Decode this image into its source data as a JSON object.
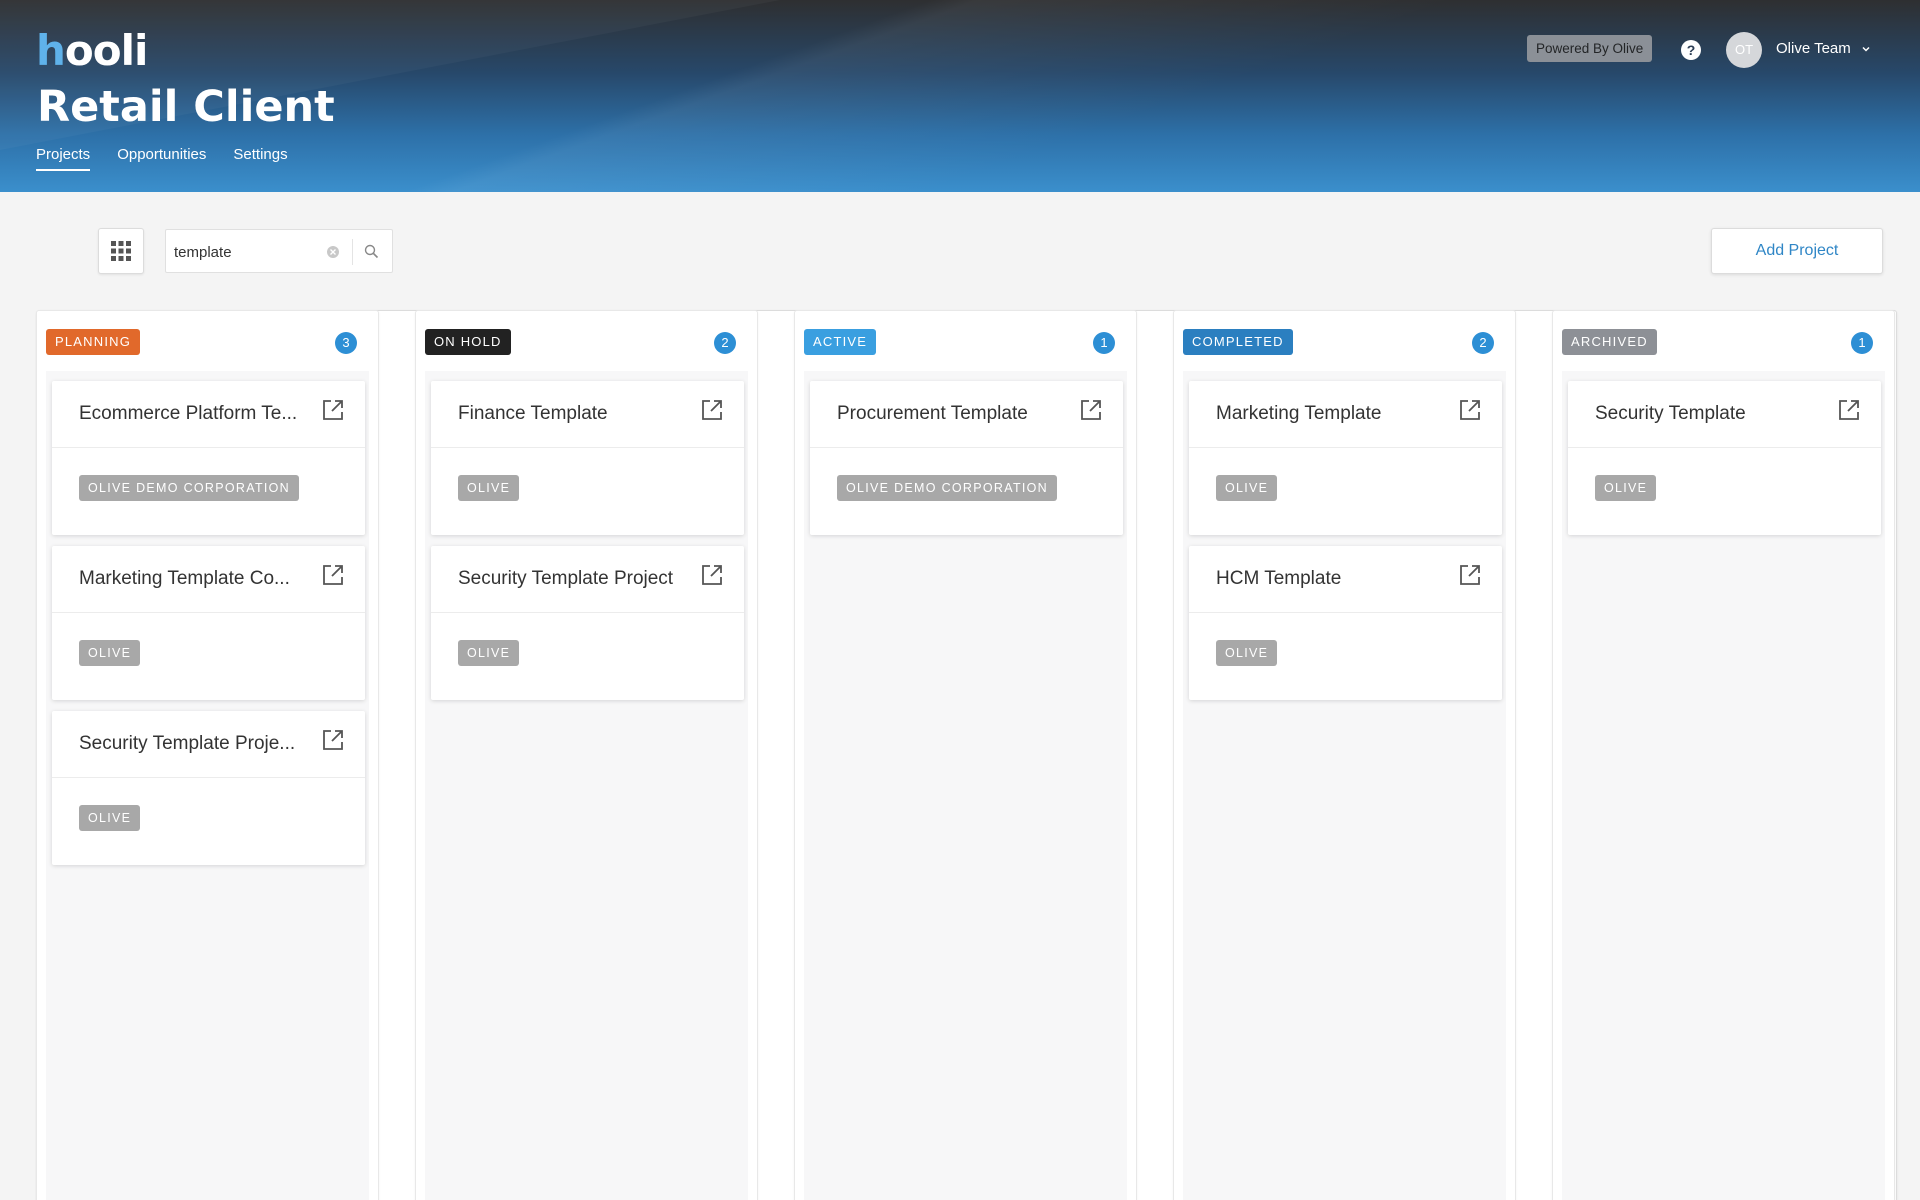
{
  "header": {
    "logo_main": "hooli",
    "title": "Retail Client",
    "tabs": [
      {
        "label": "Projects",
        "active": true
      },
      {
        "label": "Opportunities",
        "active": false
      },
      {
        "label": "Settings",
        "active": false
      }
    ],
    "powered_by": "Powered By Olive",
    "help_icon": "?",
    "user": {
      "initials": "OT",
      "name": "Olive Team"
    }
  },
  "toolbar": {
    "search_value": "template",
    "search_placeholder": "Search",
    "add_project_label": "Add Project"
  },
  "colors": {
    "planning": "#e1692b",
    "on_hold": "#222222",
    "active": "#3a9fe0",
    "completed": "#2b7fc0",
    "archived": "#8d9096",
    "count": "#2d8fd5",
    "accent": "#2f86c6"
  },
  "columns": [
    {
      "status": "PLANNING",
      "count": "3",
      "cards": [
        {
          "title": "Ecommerce Platform Te...",
          "org": "OLIVE DEMO CORPORATION"
        },
        {
          "title": "Marketing Template Co...",
          "org": "OLIVE"
        },
        {
          "title": "Security Template Proje...",
          "org": "OLIVE"
        }
      ]
    },
    {
      "status": "ON HOLD",
      "count": "2",
      "cards": [
        {
          "title": "Finance Template",
          "org": "OLIVE"
        },
        {
          "title": "Security Template Project",
          "org": "OLIVE"
        }
      ]
    },
    {
      "status": "ACTIVE",
      "count": "1",
      "cards": [
        {
          "title": "Procurement Template",
          "org": "OLIVE DEMO CORPORATION"
        }
      ]
    },
    {
      "status": "COMPLETED",
      "count": "2",
      "cards": [
        {
          "title": "Marketing Template",
          "org": "OLIVE"
        },
        {
          "title": "HCM Template",
          "org": "OLIVE"
        }
      ]
    },
    {
      "status": "ARCHIVED",
      "count": "1",
      "cards": [
        {
          "title": "Security Template",
          "org": "OLIVE"
        }
      ]
    }
  ]
}
